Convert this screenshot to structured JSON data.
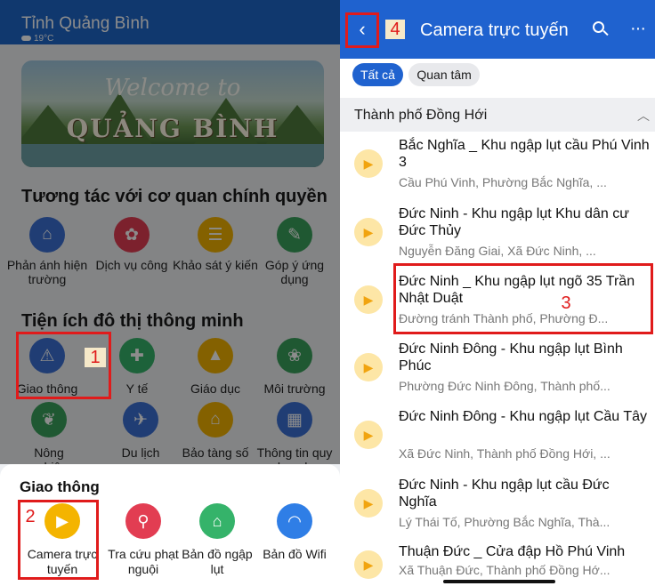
{
  "left_header": {
    "province": "Tỉnh Quảng Bình",
    "temperature": "19°C"
  },
  "banner": {
    "welcome": "Welcome to",
    "place": "QUẢNG BÌNH"
  },
  "section_gov": {
    "title": "Tương tác với cơ quan chính quyền",
    "items": [
      {
        "label": "Phản ánh hiện trường",
        "icon": "feedback-icon",
        "color": "#3b6fd4",
        "glyph": "⌂"
      },
      {
        "label": "Dịch vụ công",
        "icon": "public-service-icon",
        "color": "#e23d52",
        "glyph": "✿"
      },
      {
        "label": "Khảo sát ý kiến",
        "icon": "survey-icon",
        "color": "#f0b100",
        "glyph": "☰"
      },
      {
        "label": "Góp ý ứng dụng",
        "icon": "app-feedback-icon",
        "color": "#3aa05b",
        "glyph": "✎"
      }
    ]
  },
  "section_city": {
    "title": "Tiện ích đô thị thông minh",
    "items": [
      {
        "label": "Giao thông",
        "icon": "traffic-icon",
        "color": "#3b6fd4",
        "glyph": "⚠"
      },
      {
        "label": "Y tế",
        "icon": "health-icon",
        "color": "#35b36a",
        "glyph": "✚"
      },
      {
        "label": "Giáo dục",
        "icon": "education-icon",
        "color": "#f0b100",
        "glyph": "▲"
      },
      {
        "label": "Môi trường",
        "icon": "environment-icon",
        "color": "#3aa05b",
        "glyph": "❀"
      },
      {
        "label": "Nông nghiệp",
        "icon": "agriculture-icon",
        "color": "#3aa05b",
        "glyph": "❦"
      },
      {
        "label": "Du lịch",
        "icon": "tourism-icon",
        "color": "#3b6fd4",
        "glyph": "✈"
      },
      {
        "label": "Bảo tàng số",
        "icon": "museum-icon",
        "color": "#f0b100",
        "glyph": "⌂"
      },
      {
        "label": "Thông tin quy hoạch",
        "icon": "planning-icon",
        "color": "#3b6fd4",
        "glyph": "▦"
      }
    ]
  },
  "sheet": {
    "title": "Giao thông",
    "items": [
      {
        "label": "Camera trực tuyến",
        "icon": "camera-icon",
        "color": "#f4b400",
        "glyph": "▶"
      },
      {
        "label": "Tra cứu phạt nguội",
        "icon": "fine-lookup-icon",
        "color": "#e23d52",
        "glyph": "⚲"
      },
      {
        "label": "Bản đồ ngập lụt",
        "icon": "flood-map-icon",
        "color": "#35b36a",
        "glyph": "⌂"
      },
      {
        "label": "Bản đồ Wifi",
        "icon": "wifi-icon",
        "color": "#2f7ee6",
        "glyph": "◠"
      }
    ]
  },
  "annotations": {
    "tag1": "1",
    "tag2": "2",
    "tag3": "3",
    "tag4": "4"
  },
  "right_header": {
    "title": "Camera trực tuyến",
    "back_glyph": "‹",
    "more_glyph": "···"
  },
  "chips": {
    "all": "Tất cả",
    "favorite": "Quan tâm"
  },
  "group": {
    "name": "Thành phố Đồng Hới",
    "chevron": "︿"
  },
  "cameras": [
    {
      "title": "Bắc Nghĩa _ Khu ngập lụt cầu Phú Vinh 3",
      "subtitle": "Cầu Phú Vinh, Phường Bắc Nghĩa, ..."
    },
    {
      "title": "Đức Ninh - Khu ngập lụt Khu dân cư Đức Thủy",
      "subtitle": "Nguyễn Đăng Giai, Xã Đức Ninh, ..."
    },
    {
      "title": "Đức Ninh _ Khu ngập lụt ngõ 35 Trần Nhật Duật",
      "subtitle": "Đường tránh Thành phố, Phường Đ..."
    },
    {
      "title": "Đức Ninh Đông - Khu ngập lụt Bình Phúc",
      "subtitle": "Phường Đức Ninh Đông, Thành phố..."
    },
    {
      "title": "Đức Ninh Đông - Khu ngập lụt Cầu Tây",
      "subtitle": "Xã Đức Ninh, Thành phố Đồng Hới, ..."
    },
    {
      "title": "Đức Ninh - Khu ngập lụt cầu Đức Nghĩa",
      "subtitle": "Lý Thái Tố, Phường Bắc Nghĩa, Thà..."
    },
    {
      "title": "Thuận Đức _ Cửa đập Hồ Phú Vinh",
      "subtitle": "Xã Thuận Đức, Thành phố Đồng Hớ..."
    }
  ]
}
